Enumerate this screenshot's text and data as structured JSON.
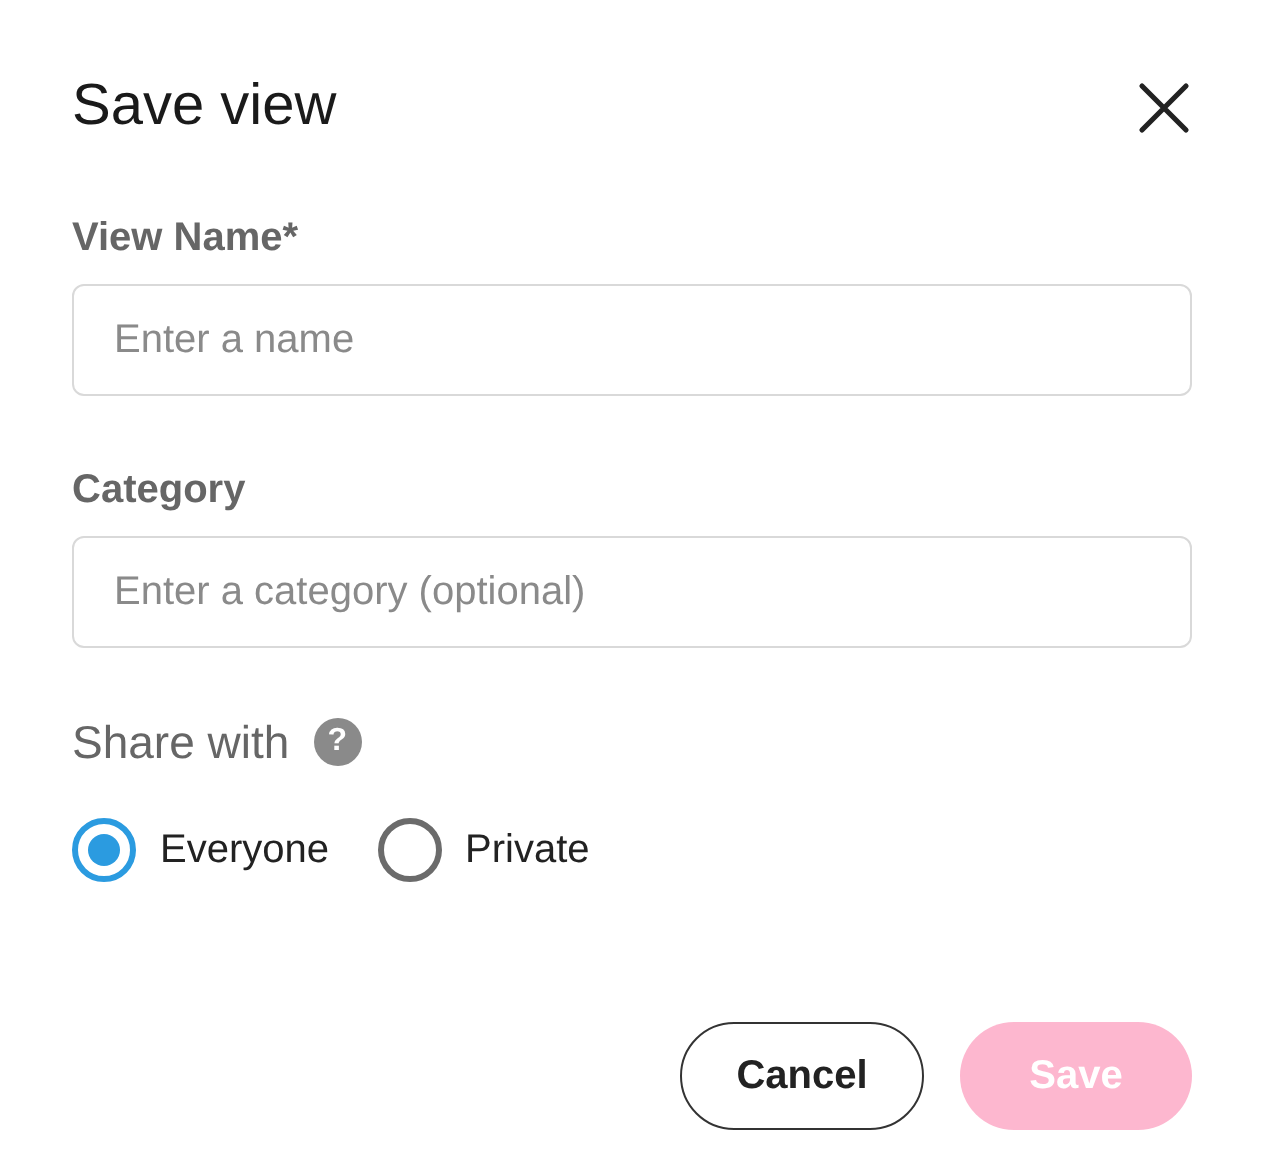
{
  "dialog": {
    "title": "Save view"
  },
  "fields": [
    {
      "label": "View Name*",
      "placeholder": "Enter a name"
    },
    {
      "label": "Category",
      "placeholder": "Enter a category (optional)"
    }
  ],
  "share": {
    "label": "Share with",
    "help_icon": "?",
    "options": [
      {
        "label": "Everyone",
        "selected": true
      },
      {
        "label": "Private",
        "selected": false
      }
    ]
  },
  "buttons": [
    {
      "label": "Cancel",
      "kind": "secondary",
      "disabled": false
    },
    {
      "label": "Save",
      "kind": "primary",
      "disabled": true
    }
  ]
}
